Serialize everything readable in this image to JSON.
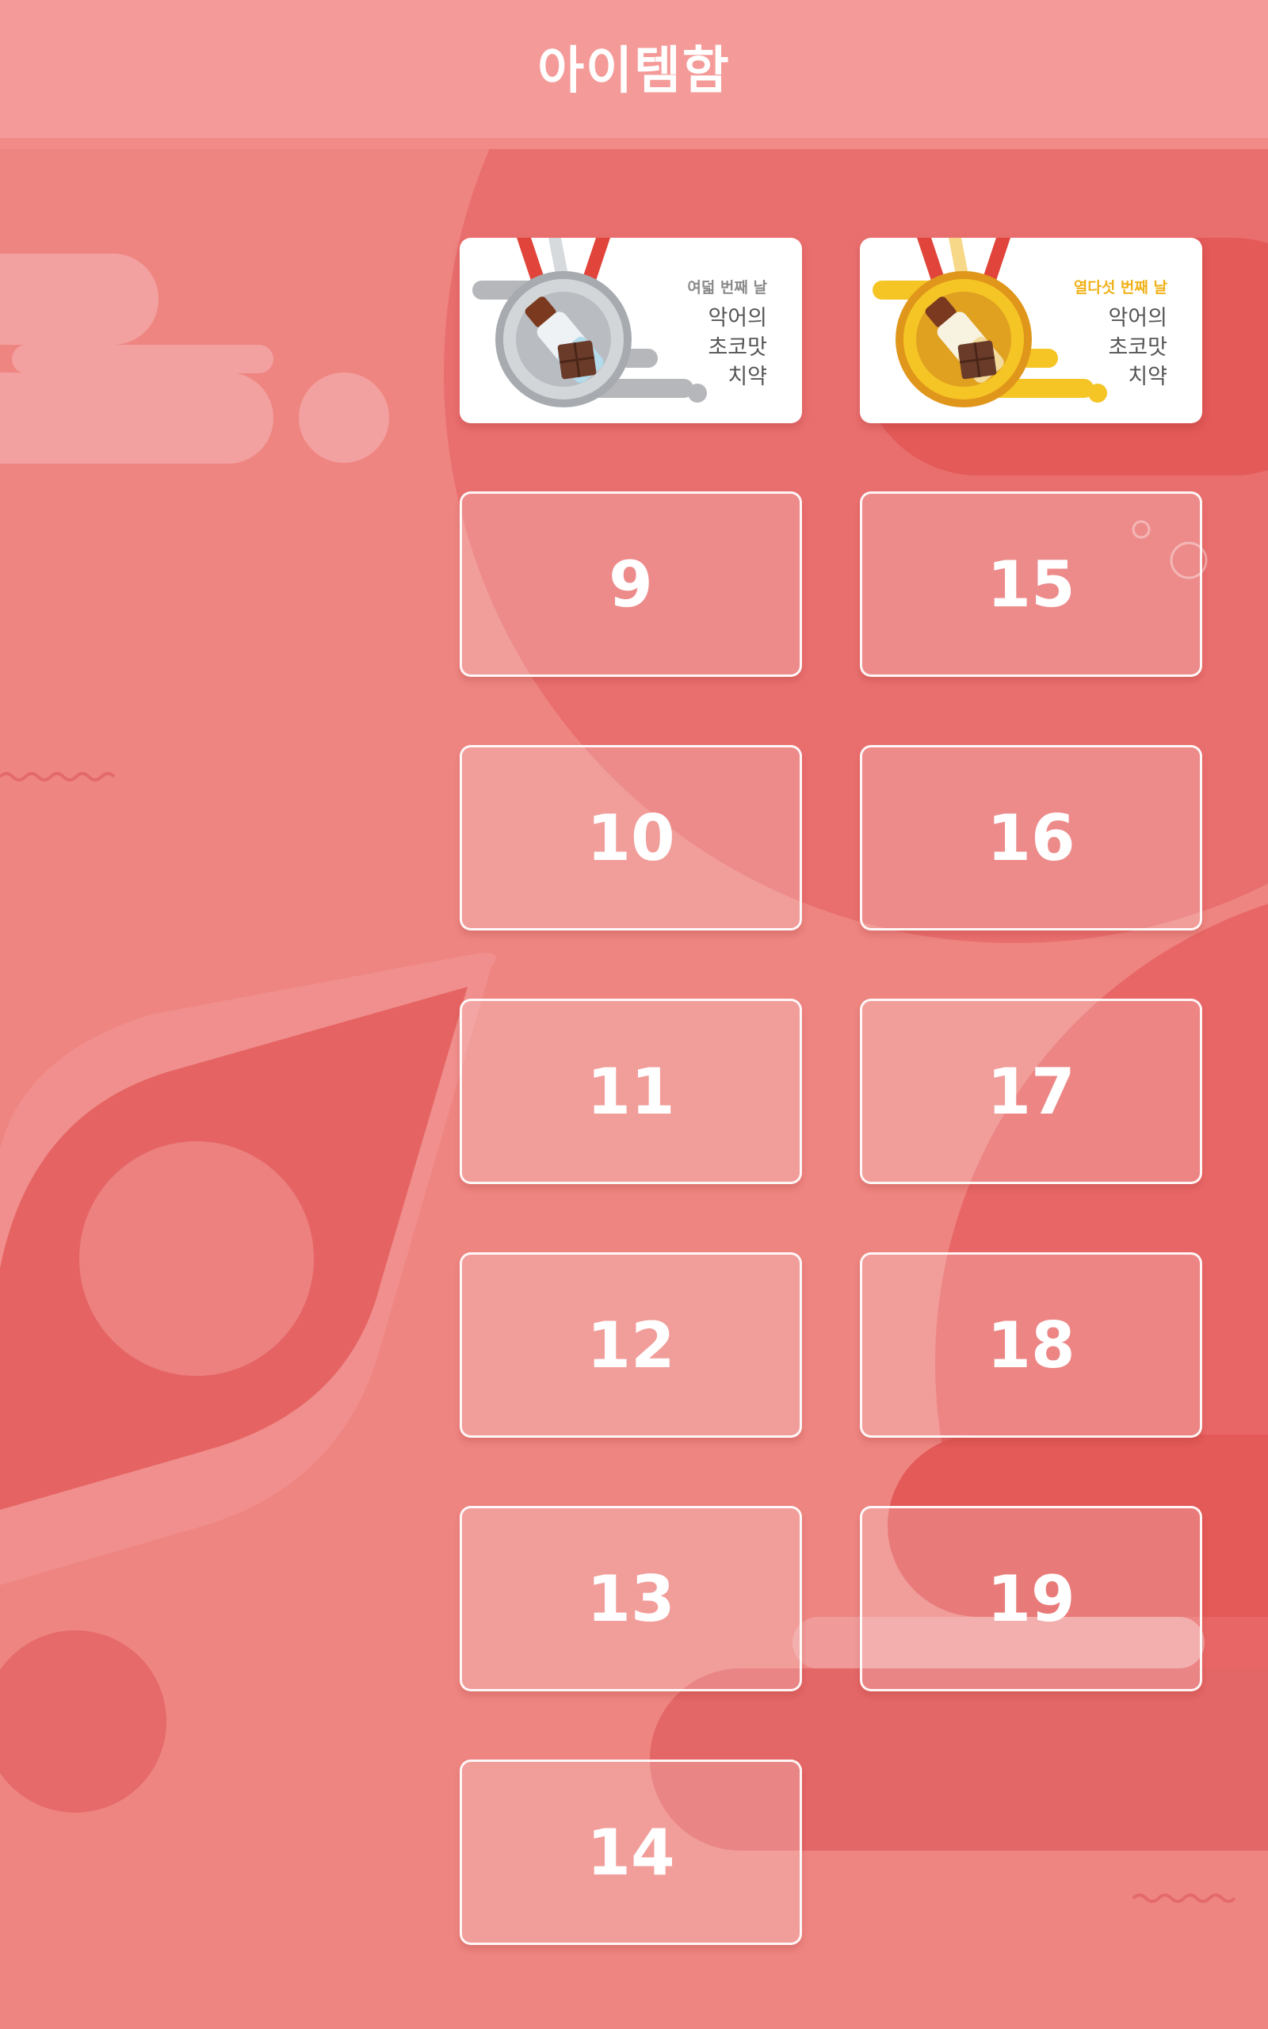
{
  "header": {
    "title": "아이템함"
  },
  "medals": [
    {
      "tier": "silver",
      "day_label": "여덟 번째 날",
      "name_lines": [
        "악어의",
        "초코맛",
        "치약"
      ],
      "icon": "chocolate-toothpaste-icon",
      "accent": "#b9bdc2"
    },
    {
      "tier": "gold",
      "day_label": "열다섯 번째 날",
      "name_lines": [
        "악어의",
        "초코맛",
        "치약"
      ],
      "icon": "chocolate-toothpaste-icon",
      "accent": "#f0b21a"
    }
  ],
  "locked_days": {
    "left": [
      "9",
      "10",
      "11",
      "12",
      "13",
      "14"
    ],
    "right": [
      "15",
      "16",
      "17",
      "18",
      "19"
    ]
  },
  "colors": {
    "background": "#ee8581",
    "header": "#f49b99",
    "ribbon": "#e0443a"
  }
}
